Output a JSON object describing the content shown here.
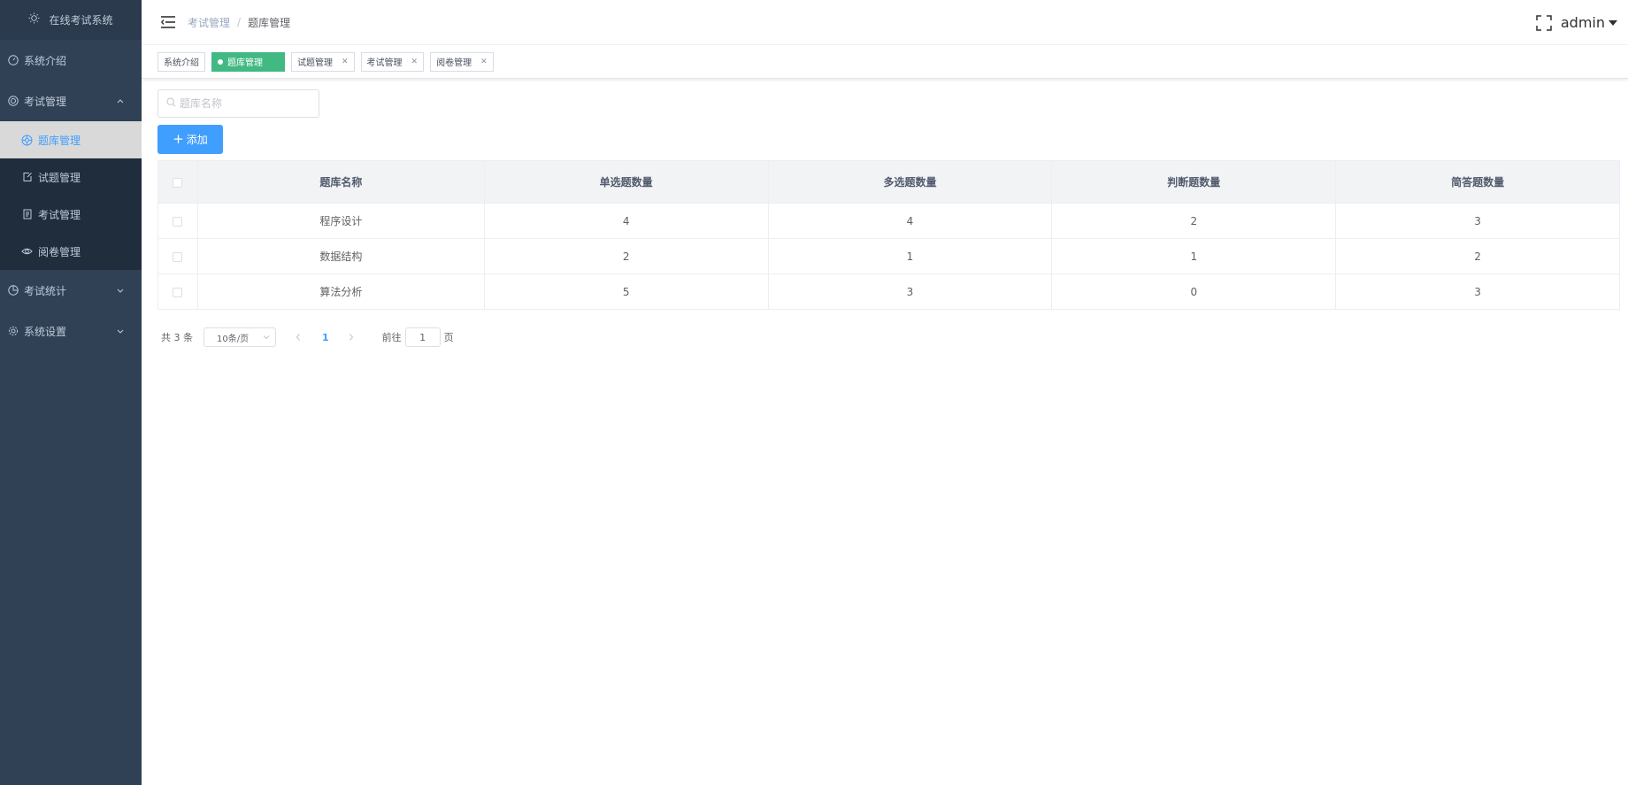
{
  "app": {
    "title": "在线考试系统",
    "logo_icon": "sun-icon"
  },
  "sidebar": {
    "items": [
      {
        "label": "系统介绍",
        "icon": "info-icon"
      },
      {
        "label": "考试管理",
        "icon": "settings-icon",
        "expanded": true,
        "children": [
          {
            "label": "题库管理",
            "icon": "compass-icon",
            "active": true
          },
          {
            "label": "试题管理",
            "icon": "edit-icon"
          },
          {
            "label": "考试管理",
            "icon": "document-icon"
          },
          {
            "label": "阅卷管理",
            "icon": "eye-icon"
          }
        ]
      },
      {
        "label": "考试统计",
        "icon": "pie-chart-icon"
      },
      {
        "label": "系统设置",
        "icon": "gear-icon"
      }
    ]
  },
  "breadcrumb": [
    "考试管理",
    "题库管理"
  ],
  "header": {
    "user": "admin"
  },
  "tags": [
    {
      "label": "系统介绍",
      "closable": false,
      "active": false
    },
    {
      "label": "题库管理",
      "closable": false,
      "active": true
    },
    {
      "label": "试题管理",
      "closable": true,
      "active": false
    },
    {
      "label": "考试管理",
      "closable": true,
      "active": false
    },
    {
      "label": "阅卷管理",
      "closable": true,
      "active": false
    }
  ],
  "search": {
    "placeholder": "题库名称",
    "value": ""
  },
  "add_button": {
    "label": "添加"
  },
  "table": {
    "columns": [
      "题库名称",
      "单选题数量",
      "多选题数量",
      "判断题数量",
      "简答题数量"
    ],
    "rows": [
      [
        "程序设计",
        "4",
        "4",
        "2",
        "3"
      ],
      [
        "数据结构",
        "2",
        "1",
        "1",
        "2"
      ],
      [
        "算法分析",
        "5",
        "3",
        "0",
        "3"
      ]
    ]
  },
  "pagination": {
    "total_text": "共 3 条",
    "page_size": "10条/页",
    "current_page": "1",
    "goto_label": "前往",
    "goto_value": "1",
    "page_suffix": "页"
  },
  "colors": {
    "sidebar_bg": "#304156",
    "primary": "#409eff",
    "tag_active": "#42b983"
  }
}
